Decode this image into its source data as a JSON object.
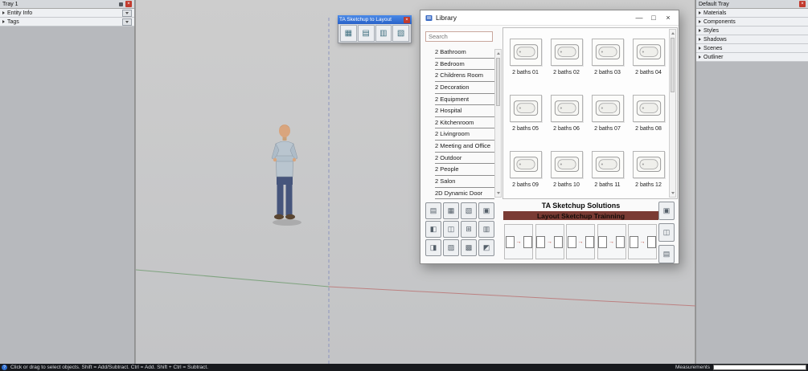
{
  "left_tray": {
    "title": "Tray 1",
    "items": [
      "Entity Info",
      "Tags"
    ]
  },
  "float_toolbar": {
    "title": "TA Sketchup to Layout",
    "buttons": [
      "▦",
      "▤",
      "▥",
      "▧"
    ]
  },
  "library": {
    "title": "Library",
    "window_controls": {
      "minimize": "—",
      "maximize": "□",
      "close": "×"
    },
    "search": {
      "placeholder": "Search"
    },
    "categories": [
      "2 Bathroom",
      "2 Bedroom",
      "2 Childrens Room",
      "2 Decoration",
      "2 Equipment",
      "2 Hospital",
      "2 Kitchenroom",
      "2 Livingroom",
      "2 Meeting and Office",
      "2 Outdoor",
      "2 People",
      "2 Salon",
      "2D Dynamic Door"
    ],
    "products": [
      "2 baths 01",
      "2 baths 02",
      "2 baths 03",
      "2 baths 04",
      "2 baths 05",
      "2 baths 06",
      "2 baths 07",
      "2 baths 08",
      "2 baths 09",
      "2 baths 10",
      "2 baths 11",
      "2 baths 12"
    ],
    "brand": {
      "title": "TA Sketchup Solutions",
      "subtitle": "Layout Sketchup Trainning"
    },
    "shortcut_glyphs": [
      "▤",
      "▦",
      "▧",
      "▣",
      "◧",
      "◫",
      "⊞",
      "▥",
      "◨",
      "▨",
      "▩",
      "◩"
    ],
    "transfer_glyphs": [
      "→",
      "→",
      "→",
      "→",
      "→"
    ],
    "side_glyphs": [
      "▣",
      "◫",
      "▤"
    ]
  },
  "right_tray": {
    "title": "Default Tray",
    "items": [
      "Materials",
      "Components",
      "Styles",
      "Shadows",
      "Scenes",
      "Outliner"
    ]
  },
  "status_bar": {
    "help_glyph": "?",
    "hint": "Click or drag to select objects. Shift = Add/Subtract. Ctrl = Add. Shift + Ctrl = Subtract.",
    "measurements_label": "Measurements",
    "measurements_value": ""
  },
  "colors": {
    "accent_blue": "#2f66c8",
    "brand_maroon": "#7a3b34",
    "close_red": "#c23b2e"
  }
}
